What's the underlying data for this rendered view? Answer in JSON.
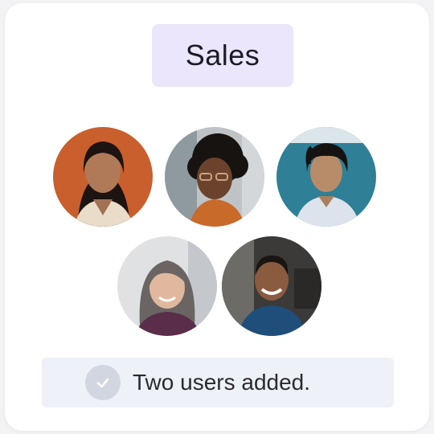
{
  "team": {
    "label": "Sales"
  },
  "members": [
    {
      "icon": "avatar-woman-orange-background"
    },
    {
      "icon": "avatar-woman-curly-hair"
    },
    {
      "icon": "avatar-man-teal-background"
    },
    {
      "icon": "avatar-woman-gray-hair"
    },
    {
      "icon": "avatar-man-smiling"
    }
  ],
  "toast": {
    "message": "Two users added.",
    "icon": "check-circle-icon"
  },
  "colors": {
    "pill_background": "#ebe6fb",
    "toast_background": "#eef1f7",
    "check_background": "#d2d6e1",
    "check_mark": "#ffffff"
  }
}
